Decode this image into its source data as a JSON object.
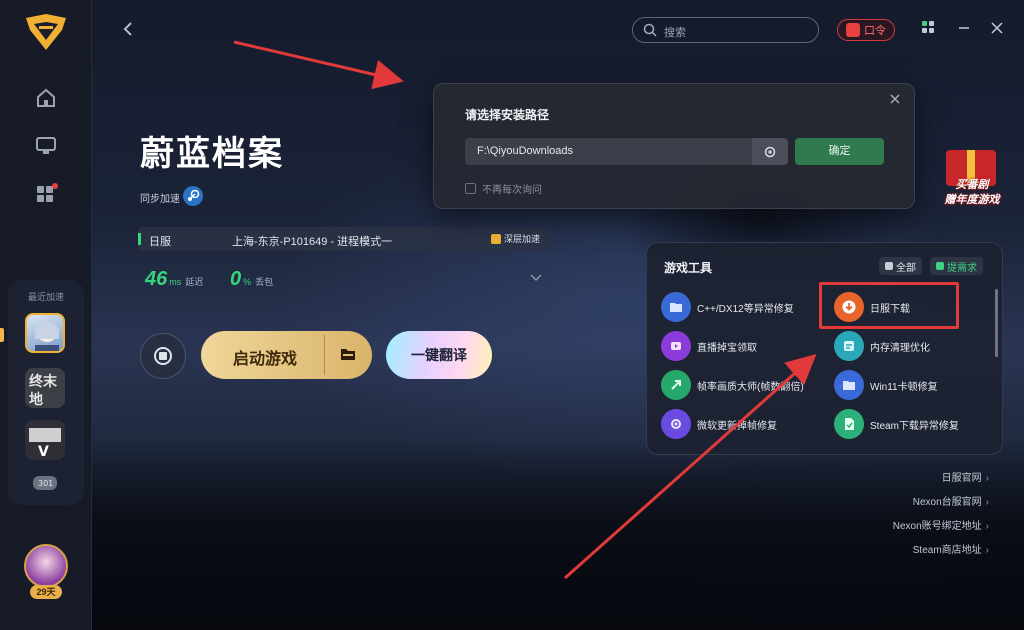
{
  "header": {
    "search_placeholder": "搜索",
    "kouling_label": "口令"
  },
  "game": {
    "title": "蔚蓝档案",
    "sync_label": "同步加速",
    "server": "日服",
    "node": "上海-东京-P101649 - 进程模式一",
    "deep_accel": "深层加速",
    "latency_value": "46",
    "latency_unit": "ms",
    "latency_label": "延迟",
    "loss_value": "0",
    "loss_unit": "%",
    "loss_label": "丢包"
  },
  "actions": {
    "start_label": "启动游戏",
    "translate_label": "一键翻译"
  },
  "sidebar": {
    "recent_label": "最近加速",
    "days_badge": "29天",
    "recent_games": [
      {
        "name": "蔚蓝档案"
      },
      {
        "name": "终末地"
      },
      {
        "name": "GTA V"
      },
      {
        "name": "301"
      }
    ]
  },
  "dialog": {
    "title": "请选择安装路径",
    "path_value": "F:\\QiyouDownloads",
    "confirm_label": "确定",
    "noask_label": "不再每次询问"
  },
  "promo": {
    "line1": "买番剧",
    "line2": "赠年度游戏"
  },
  "tools": {
    "title": "游戏工具",
    "chip_all": "全部",
    "chip_request": "提需求",
    "items": [
      {
        "label": "C++/DX12等异常修复",
        "icon": "wrench-folder-icon",
        "color": "#3a6ad8"
      },
      {
        "label": "日服下载",
        "icon": "download-icon",
        "color": "#e8642a"
      },
      {
        "label": "直播掉宝领取",
        "icon": "live-gift-icon",
        "color": "#8a3bd9"
      },
      {
        "label": "内存清理优化",
        "icon": "memory-icon",
        "color": "#2aa7b8"
      },
      {
        "label": "帧率画质大师(帧数翻倍)",
        "icon": "fps-icon",
        "color": "#27a86b"
      },
      {
        "label": "Win11卡顿修复",
        "icon": "folder-fix-icon",
        "color": "#3a6ad8"
      },
      {
        "label": "微软更新掉帧修复",
        "icon": "gear-fix-icon",
        "color": "#6a4ae0"
      },
      {
        "label": "Steam下载异常修复",
        "icon": "file-fix-icon",
        "color": "#2bb07a"
      }
    ]
  },
  "links": [
    {
      "label": "日服官网"
    },
    {
      "label": "Nexon台服官网"
    },
    {
      "label": "Nexon账号绑定地址"
    },
    {
      "label": "Steam商店地址"
    }
  ],
  "colors": {
    "accent_green": "#39d57a",
    "start_gold": "#e3c07e",
    "highlight_red": "#e23a3a"
  }
}
